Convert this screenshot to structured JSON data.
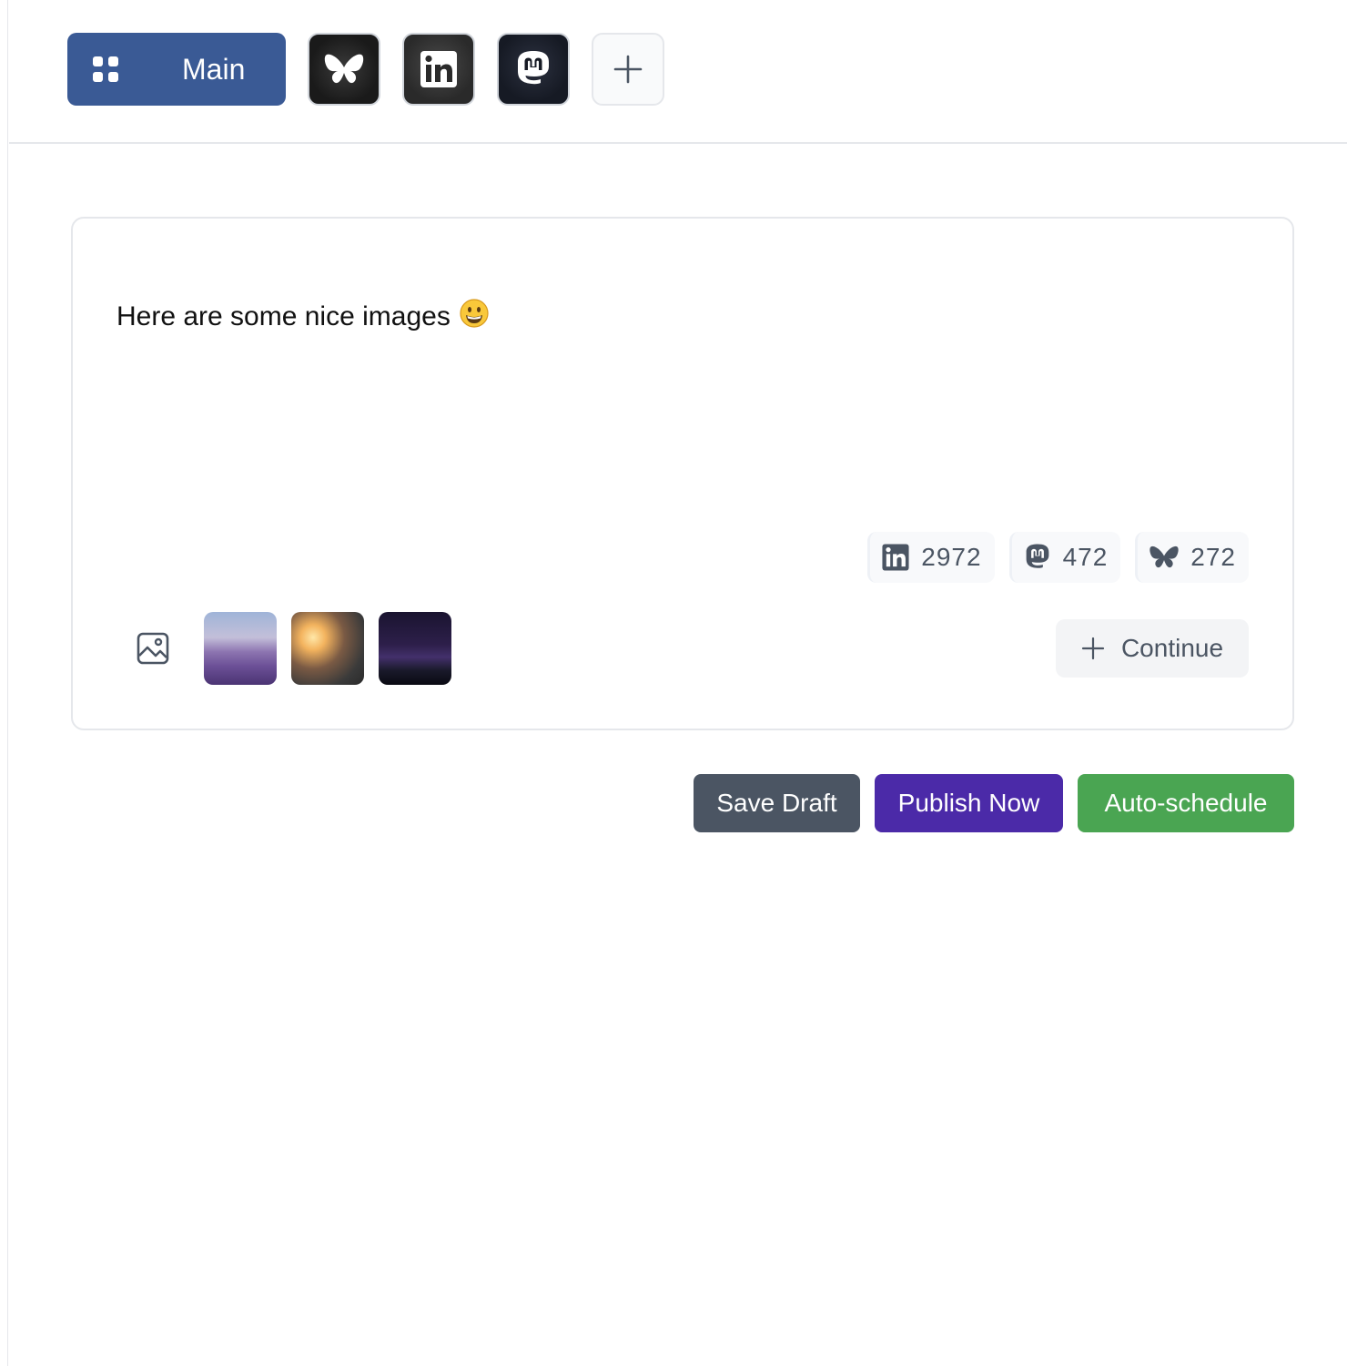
{
  "header": {
    "main_tab_label": "Main",
    "accounts": [
      {
        "network": "bluesky",
        "icon": "bluesky-butterfly-icon"
      },
      {
        "network": "linkedin",
        "icon": "linkedin-icon"
      },
      {
        "network": "mastodon",
        "icon": "mastodon-icon"
      }
    ],
    "add_account_icon": "plus-icon"
  },
  "editor": {
    "text": "Here are some nice images",
    "emoji": "grinning-face",
    "char_counts": [
      {
        "network": "linkedin",
        "icon": "linkedin-icon",
        "remaining": "2972"
      },
      {
        "network": "mastodon",
        "icon": "mastodon-icon",
        "remaining": "472"
      },
      {
        "network": "bluesky",
        "icon": "bluesky-butterfly-icon",
        "remaining": "272"
      }
    ],
    "media_icon": "image-icon",
    "thumbnails": [
      "lavender-field",
      "cyclists-sunset",
      "city-night"
    ],
    "continue_label": "Continue"
  },
  "actions": {
    "save_draft": "Save Draft",
    "publish_now": "Publish Now",
    "auto_schedule": "Auto-schedule"
  },
  "colors": {
    "main_tab": "#3a5a95",
    "save_draft": "#4b5563",
    "publish_now": "#4b2aa8",
    "auto_schedule": "#4aa552"
  }
}
